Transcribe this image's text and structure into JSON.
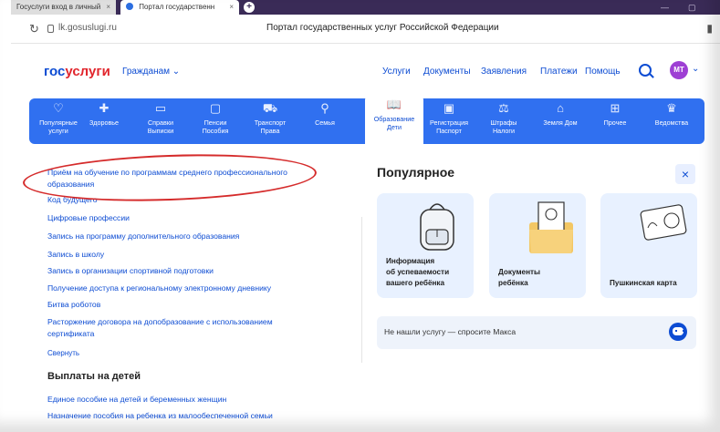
{
  "browser": {
    "tabs": [
      {
        "label": "Госуслуги вход в личный"
      },
      {
        "label": "Портал государственн"
      }
    ],
    "tab_close": "×",
    "new_tab": "+",
    "url": "lk.gosuslugi.ru",
    "page_title": "Портал государственных услуг Российской Федерации"
  },
  "header": {
    "logo_part1": "гос",
    "logo_part2": "услуги",
    "audience": "Гражданам ⌄",
    "nav": [
      "Услуги",
      "Документы",
      "Заявления",
      "Платежи",
      "Помощь"
    ],
    "avatar_initials": "МТ"
  },
  "categories": [
    {
      "label": "Популярные\nуслуги",
      "icon": "heart-icon"
    },
    {
      "label": "Здоровье",
      "icon": "medical-cross-icon"
    },
    {
      "label": "Справки\nВыписки",
      "icon": "folder-icon"
    },
    {
      "label": "Пенсии\nПособия",
      "icon": "wallet-icon"
    },
    {
      "label": "Транспорт\nПрава",
      "icon": "car-icon"
    },
    {
      "label": "Семья",
      "icon": "stroller-icon"
    },
    {
      "label": "Образование\nДети",
      "icon": "book-icon",
      "active": true
    },
    {
      "label": "Регистрация\nПаспорт",
      "icon": "passport-icon"
    },
    {
      "label": "Штрафы\nНалоги",
      "icon": "gavel-icon"
    },
    {
      "label": "Земля Дом",
      "icon": "house-icon"
    },
    {
      "label": "Прочее",
      "icon": "grid-icon"
    },
    {
      "label": "Ведомства",
      "icon": "emblem-icon"
    }
  ],
  "services": [
    "Приём на обучение по программам среднего профессионального",
    "образования",
    "Код будущего",
    "Цифровые профессии",
    "Запись на программу дополнительного образования",
    "Запись в школу",
    "Запись в организации спортивной подготовки",
    "Получение доступа к региональному электронному дневнику",
    "Битва роботов",
    "Расторжение договора на допобразование с использованием",
    "сертификата"
  ],
  "collapse_label": "Свернуть",
  "payments_section": {
    "title": "Выплаты на детей",
    "items": [
      "Единое пособие на детей и беременных женщин",
      "Назначение пособия на ребенка из малообеспеченной семьи"
    ]
  },
  "popular": {
    "title": "Популярное",
    "close": "×",
    "cards": [
      {
        "label": "Информация\nоб успеваемости\nвашего ребёнка",
        "art": "backpack-icon"
      },
      {
        "label": "Документы\nребёнка",
        "art": "documents-folder-icon"
      },
      {
        "label": "Пушкинская карта",
        "art": "pushkin-card-icon"
      }
    ],
    "ask_text": "Не нашли услугу — спросите Макса"
  },
  "colors": {
    "brand_blue": "#0d4cd3",
    "category_bar": "#3070f0",
    "brand_red": "#e1252c",
    "annotation_red": "#d52b2b",
    "avatar": "#9e3fd4"
  }
}
